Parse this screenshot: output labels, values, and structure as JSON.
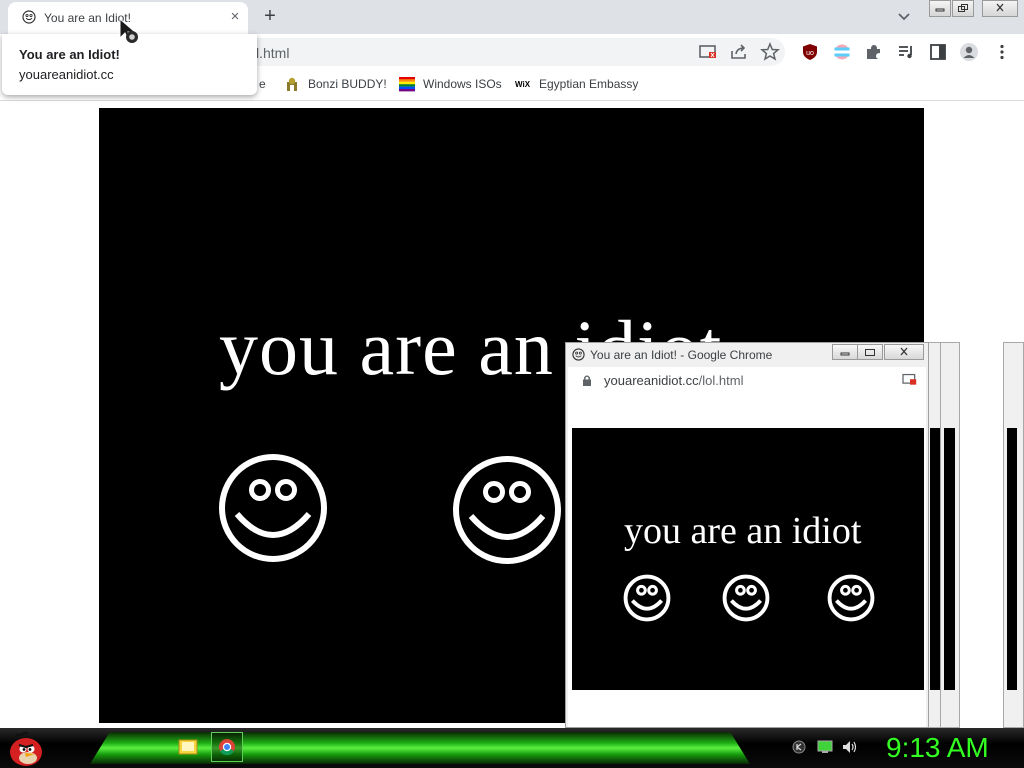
{
  "browser": {
    "tab": {
      "title": "You are an Idiot!",
      "close_glyph": "×"
    },
    "new_tab_glyph": "+",
    "address_visible_fragment": "l.html",
    "hover_card": {
      "title": "You are an Idiot!",
      "domain": "youareanidiot.cc"
    },
    "bookmarks": [
      {
        "label": "e",
        "icon": "partial-bookmark"
      },
      {
        "label": "Bonzi BUDDY!",
        "icon": "bonzi-icon"
      },
      {
        "label": "Windows ISOs",
        "icon": "windows-flag-icon"
      },
      {
        "label": "Egyptian Embassy",
        "icon": "wix-icon"
      }
    ],
    "toolbar_icons": [
      "cast-icon",
      "share-icon",
      "star-icon",
      "ublock-icon",
      "extension-flag-icon",
      "puzzle-icon",
      "media-icon",
      "sidepanel-icon",
      "profile-icon",
      "menu-icon"
    ]
  },
  "page": {
    "message": "you are an idiot",
    "smileys": 3
  },
  "popup": {
    "title": "You are an Idiot! - Google Chrome",
    "url_domain": "youareanidiot.cc",
    "url_path": "/lol.html",
    "message": "you are an idiot"
  },
  "taskbar": {
    "clock": "9:13 AM",
    "apps": [
      "file-explorer-icon",
      "chrome-icon"
    ],
    "tray": [
      "keyboard-icon",
      "network-icon",
      "volume-icon"
    ]
  },
  "colors": {
    "tab_strip": "#dee1e6",
    "clock_green": "#33ff22",
    "taskbar_green": "#1fb014"
  }
}
